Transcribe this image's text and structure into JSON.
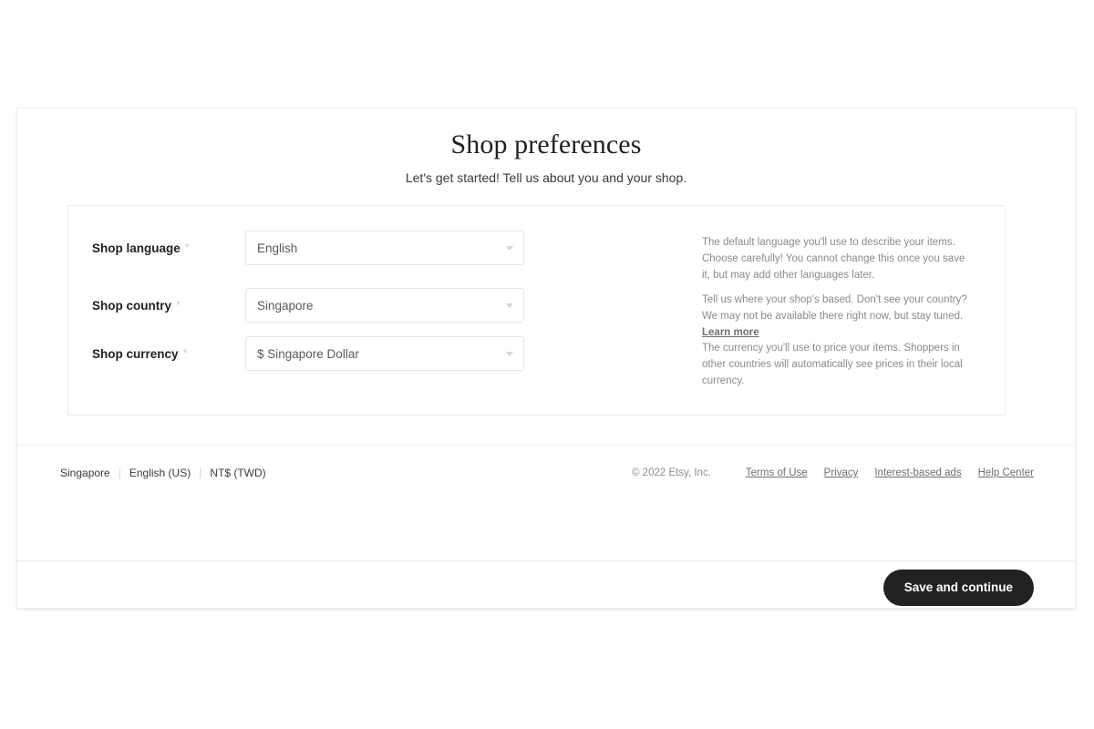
{
  "header": {
    "title": "Shop preferences",
    "subtitle": "Let's get started! Tell us about you and your shop."
  },
  "form": {
    "required_marker": "*",
    "rows": [
      {
        "label": "Shop language",
        "value": "English",
        "help": "The default language you'll use to describe your items. Choose carefully! You cannot change this once you save it, but may add other languages later.",
        "help_link": ""
      },
      {
        "label": "Shop country",
        "value": "Singapore",
        "help": "Tell us where your shop's based. Don't see your country? We may not be available there right now, but stay tuned.",
        "help_link": "Learn more"
      },
      {
        "label": "Shop currency",
        "value": "$ Singapore Dollar",
        "help": "The currency you'll use to price your items. Shoppers in other countries will automatically see prices in their local currency.",
        "help_link": ""
      }
    ]
  },
  "footer": {
    "locale": {
      "country": "Singapore",
      "language": "English (US)",
      "currency": "NT$ (TWD)",
      "separator": "|"
    },
    "copyright": "© 2022 Etsy, Inc.",
    "links": [
      "Terms of Use",
      "Privacy",
      "Interest-based ads",
      "Help Center"
    ]
  },
  "actions": {
    "submit_label": "Save and continue"
  },
  "colors": {
    "button_background": "#222222",
    "button_text": "#ffffff",
    "required_marker": "#c5d4cd",
    "help_text": "#8a8a8a",
    "border": "#eeeeee"
  }
}
